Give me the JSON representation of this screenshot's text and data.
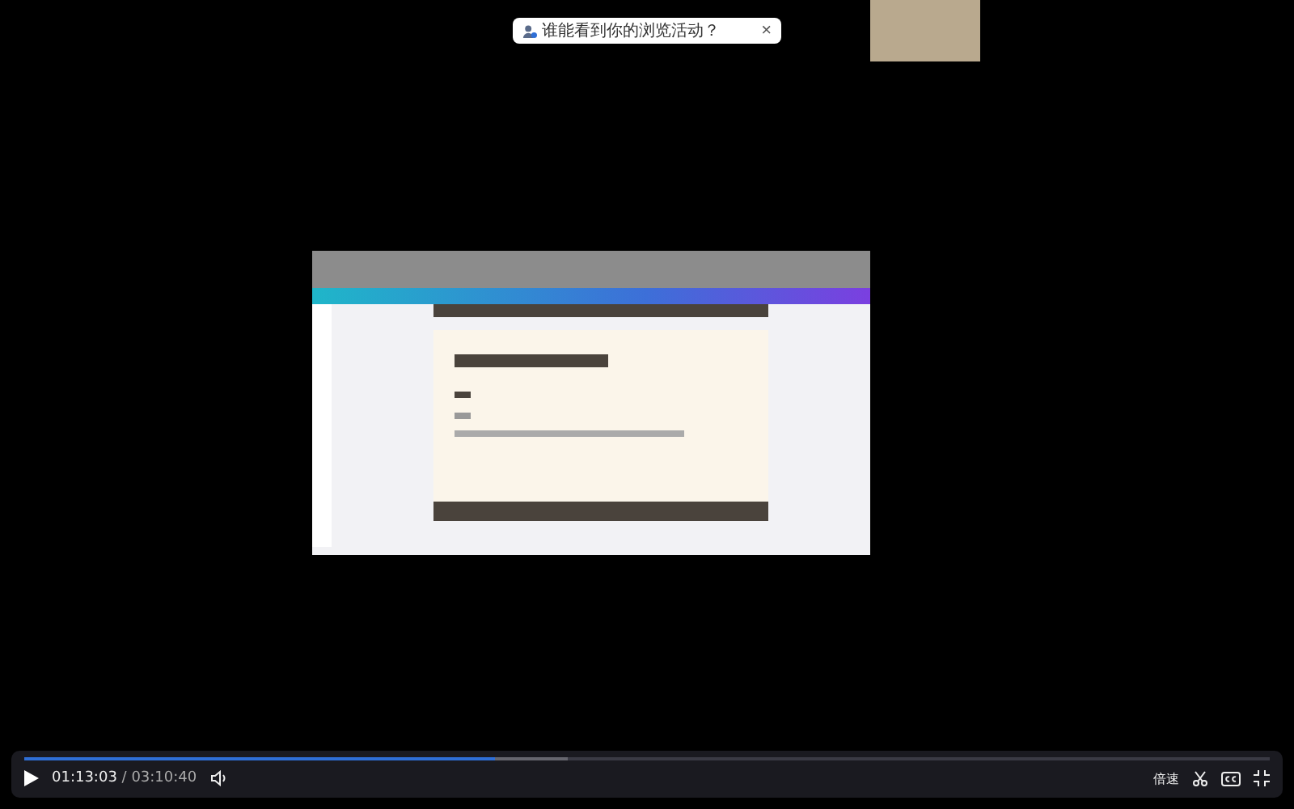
{
  "notice": {
    "text": "谁能看到你的浏览活动？",
    "close": "×"
  },
  "player": {
    "progress": {
      "level": 0.378
    },
    "buffer": {
      "level": 0.436
    },
    "playing": false,
    "current_time": "01:13:03",
    "separator": "/",
    "duration": "03:10:40",
    "speed": "倍速"
  }
}
